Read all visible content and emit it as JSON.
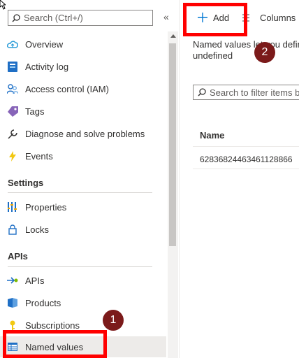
{
  "sidebar": {
    "search_placeholder": "Search (Ctrl+/)",
    "collapse_glyph": "«",
    "items_top": [
      {
        "label": "Overview",
        "icon": "cloud-icon"
      },
      {
        "label": "Activity log",
        "icon": "activity-log-icon"
      },
      {
        "label": "Access control (IAM)",
        "icon": "people-icon"
      },
      {
        "label": "Tags",
        "icon": "tag-icon"
      },
      {
        "label": "Diagnose and solve problems",
        "icon": "wrench-icon"
      },
      {
        "label": "Events",
        "icon": "lightning-icon"
      }
    ],
    "section_settings": "Settings",
    "items_settings": [
      {
        "label": "Properties",
        "icon": "properties-icon"
      },
      {
        "label": "Locks",
        "icon": "lock-icon"
      }
    ],
    "section_apis": "APIs",
    "items_apis": [
      {
        "label": "APIs",
        "icon": "api-icon"
      },
      {
        "label": "Products",
        "icon": "products-icon"
      },
      {
        "label": "Subscriptions",
        "icon": "key-icon"
      },
      {
        "label": "Named values",
        "icon": "named-values-icon",
        "selected": true
      }
    ]
  },
  "toolbar": {
    "add_label": "Add",
    "columns_label": "Columns"
  },
  "main": {
    "description": "Named values let you defin undefined",
    "filter_placeholder": "Search to filter items b",
    "table": {
      "column_header": "Name",
      "rows": [
        "62836824463461128866"
      ]
    }
  },
  "annotations": {
    "badge_1": "1",
    "badge_2": "2"
  },
  "colors": {
    "highlight": "#ff0000",
    "badge": "#7b1a1a",
    "selected_bg": "#edebe9",
    "accent": "#0078d4"
  }
}
